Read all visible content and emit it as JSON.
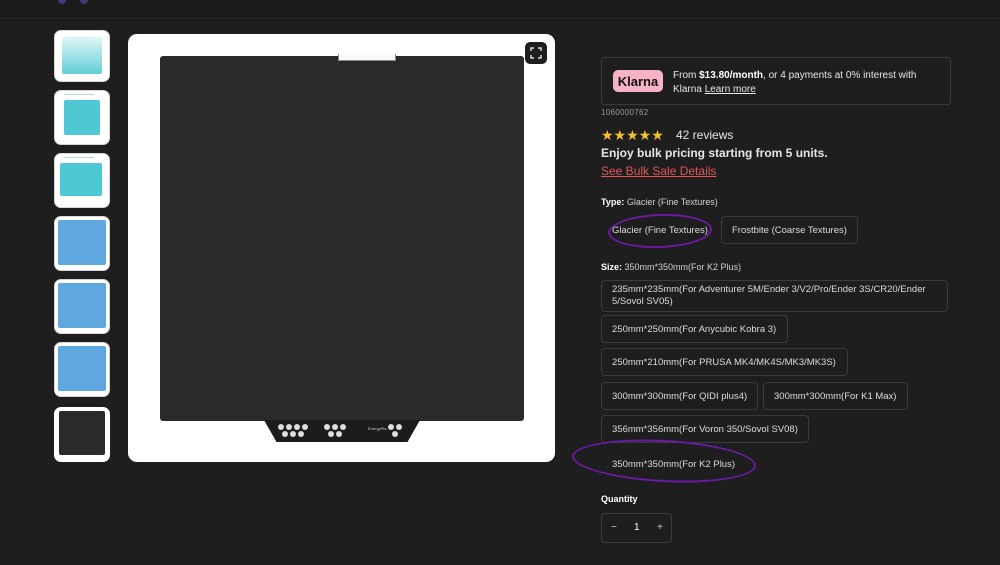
{
  "colors": {
    "background": "#1e1e1e",
    "accent_link": "#e35757",
    "star": "#f4c22e",
    "annotation": "#6a1ba3",
    "klarna": "#f7b3c6"
  },
  "gallery": {
    "thumbnails": [
      {
        "name": "gradient-sheet",
        "color": "#62ced6"
      },
      {
        "name": "glacier-sheet-dim-1",
        "color": "#4ec9d3"
      },
      {
        "name": "glacier-sheet-dim-2",
        "color": "#4ec9d3"
      },
      {
        "name": "frostbite-sheet-1",
        "color": "#5fa8df"
      },
      {
        "name": "frostbite-sheet-2",
        "color": "#5fa8df"
      },
      {
        "name": "frostbite-sheet-3",
        "color": "#5fa8df"
      },
      {
        "name": "black-sheet",
        "color": "#2b2b2b"
      }
    ],
    "expand_icon": "expand-icon",
    "plate_brand": "EnergyPla"
  },
  "klarna": {
    "logo": "Klarna",
    "text_prefix": "From ",
    "amount": "$13.80/month",
    "text_suffix": ", or 4 payments at 0% interest with Klarna ",
    "link": "Learn more"
  },
  "product": {
    "sku": "1060000762",
    "stars": "★★★★★",
    "reviews": "42 reviews",
    "bulk_text": "Enjoy bulk pricing starting from 5 units.",
    "bulk_link": "See Bulk Sale Details"
  },
  "type": {
    "label": "Type:",
    "selected_value": "Glacier (Fine Textures)",
    "options": [
      "Glacier (Fine Textures)",
      "Frostbite (Coarse Textures)"
    ]
  },
  "size": {
    "label": "Size:",
    "selected_value": "350mm*350mm(For K2 Plus)",
    "options": [
      "235mm*235mm(For Adventurer 5M/Ender 3/V2/Pro/Ender 3S/CR20/Ender 5/Sovol SV05)",
      "250mm*250mm(For Anycubic Kobra 3)",
      "250mm*210mm(For PRUSA MK4/MK4S/MK3/MK3S)",
      "300mm*300mm(For QIDI plus4)",
      "300mm*300mm(For K1 Max)",
      "356mm*356mm(For Voron 350/Sovol SV08)",
      "350mm*350mm(For K2 Plus)"
    ]
  },
  "quantity": {
    "label": "Quantity",
    "minus": "−",
    "value": "1",
    "plus": "+"
  }
}
